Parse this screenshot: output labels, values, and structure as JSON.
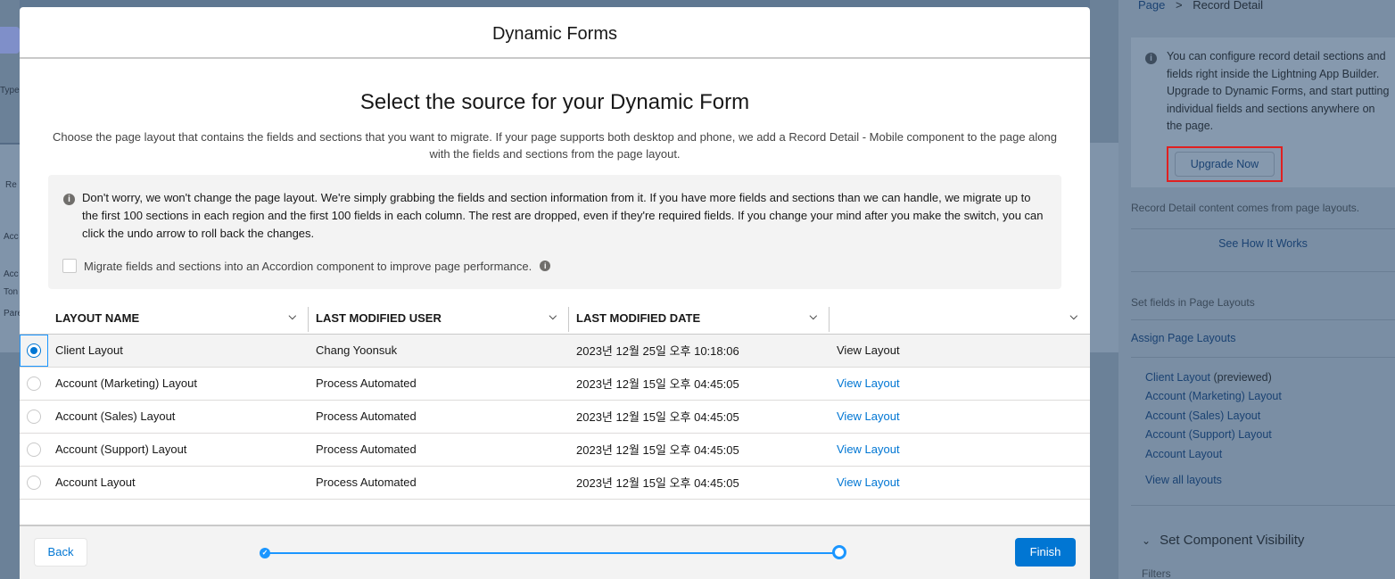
{
  "background": {
    "left_labels": [
      "Type",
      "Re",
      "Acc",
      "Acc",
      "Ton",
      "Pare"
    ],
    "breadcrumb": {
      "parent": "Page",
      "separator": ">",
      "current": "Record Detail"
    },
    "info_text": "You can configure record detail sections and fields right inside the Lightning App Builder. Upgrade to Dynamic Forms, and start putting individual fields and sections anywhere on the page.",
    "upgrade_label": "Upgrade Now",
    "content_note": "Record Detail content comes from page layouts.",
    "see_how_label": "See How It Works",
    "set_fields_label": "Set fields in Page Layouts",
    "assign_label": "Assign Page Layouts",
    "layouts": [
      {
        "name": "Client Layout",
        "suffix": "(previewed)"
      },
      {
        "name": "Account (Marketing) Layout",
        "suffix": ""
      },
      {
        "name": "Account (Sales) Layout",
        "suffix": ""
      },
      {
        "name": "Account (Support) Layout",
        "suffix": ""
      },
      {
        "name": "Account Layout",
        "suffix": ""
      }
    ],
    "view_all_label": "View all layouts",
    "visibility_title": "Set Component Visibility",
    "filters_label": "Filters"
  },
  "modal": {
    "header": "Dynamic Forms",
    "title": "Select the source for your Dynamic Form",
    "subtitle": "Choose the page layout that contains the fields and sections that you want to migrate. If your page supports both desktop and phone, we add a Record Detail - Mobile component to the page along with the fields and sections from the page layout.",
    "notice": "Don't worry, we won't change the page layout. We're simply grabbing the fields and section information from it. If you have more fields and sections than we can handle, we migrate up to the first 100 sections in each region and the first 100 fields in each column. The rest are dropped, even if they're required fields. If you change your mind after you make the switch, you can click the undo arrow to roll back the changes.",
    "accordion_label": "Migrate fields and sections into an Accordion component to improve page performance.",
    "columns": [
      "LAYOUT NAME",
      "LAST MODIFIED USER",
      "LAST MODIFIED DATE",
      ""
    ],
    "rows": [
      {
        "name": "Client Layout",
        "user": "Chang Yoonsuk",
        "date": "2023년 12월 25일 오후 10:18:06",
        "action": "View Layout",
        "selected": true
      },
      {
        "name": "Account (Marketing) Layout",
        "user": "Process Automated",
        "date": "2023년 12월 15일 오후 04:45:05",
        "action": "View Layout",
        "selected": false
      },
      {
        "name": "Account (Sales) Layout",
        "user": "Process Automated",
        "date": "2023년 12월 15일 오후 04:45:05",
        "action": "View Layout",
        "selected": false
      },
      {
        "name": "Account (Support) Layout",
        "user": "Process Automated",
        "date": "2023년 12월 15일 오후 04:45:05",
        "action": "View Layout",
        "selected": false
      },
      {
        "name": "Account Layout",
        "user": "Process Automated",
        "date": "2023년 12월 15일 오후 04:45:05",
        "action": "View Layout",
        "selected": false
      }
    ],
    "back_label": "Back",
    "finish_label": "Finish",
    "progress": {
      "current_step": 2,
      "total_steps": 2
    }
  },
  "colors": {
    "brand": "#0176d3",
    "progress": "#1b96ff",
    "highlight_border": "#e02020"
  },
  "icons": {
    "info": "info-icon",
    "chevron": "chevron-down-icon",
    "check": "check-icon"
  }
}
